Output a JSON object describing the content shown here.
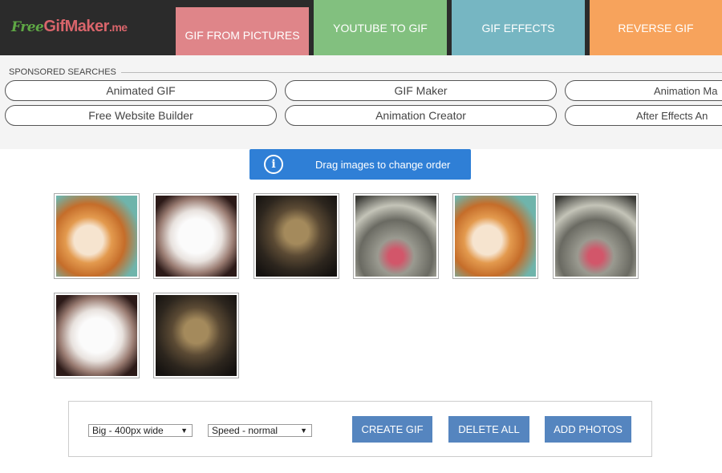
{
  "header": {
    "logo": {
      "part1": "Free",
      "part2": "GifMaker",
      "part3": ".me"
    },
    "nav": [
      {
        "label": "GIF FROM PICTURES",
        "color": "#df8589",
        "active": true
      },
      {
        "label": "YOUTUBE TO GIF",
        "color": "#82c07f"
      },
      {
        "label": "GIF EFFECTS",
        "color": "#76b6c2"
      },
      {
        "label": "REVERSE GIF",
        "color": "#f7a35c"
      }
    ]
  },
  "sponsored": {
    "label": "SPONSORED SEARCHES",
    "items": [
      "Animated GIF",
      "GIF Maker",
      "Animation Ma",
      "Free Website Builder",
      "Animation Creator",
      "After Effects An"
    ]
  },
  "info": {
    "icon": "info-icon",
    "text": "Drag images to change order"
  },
  "images": [
    {
      "name": "orange-cat"
    },
    {
      "name": "white-kitten"
    },
    {
      "name": "tabby-cat"
    },
    {
      "name": "gray-cat-licking"
    },
    {
      "name": "orange-cat"
    },
    {
      "name": "gray-cat-licking"
    },
    {
      "name": "white-kitten"
    },
    {
      "name": "tabby-cat"
    }
  ],
  "controls": {
    "size_select": "Big - 400px wide",
    "speed_select": "Speed - normal",
    "create": "CREATE GIF",
    "delete": "DELETE ALL",
    "add": "ADD PHOTOS"
  }
}
